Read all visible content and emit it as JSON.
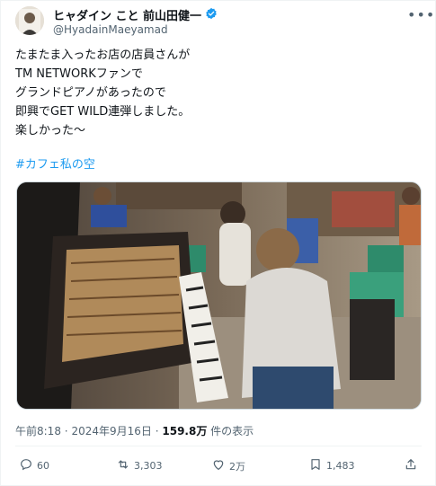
{
  "author": {
    "display_name": "ヒャダイン こと 前山田健一",
    "handle": "@HyadainMaeyamad"
  },
  "post": {
    "lines": [
      "たまたま入ったお店の店員さんが",
      "TM NETWORKファンで",
      "グランドピアノがあったので",
      "即興でGET WILD連弾しました。",
      "楽しかった〜"
    ],
    "hashtag": "#カフェ私の空"
  },
  "meta": {
    "time": "午前8:18",
    "date": "2024年9月16日",
    "views": "159.8万",
    "views_suffix": "件の表示",
    "separator": "·"
  },
  "actions": {
    "replies": "60",
    "reposts": "3,303",
    "likes": "2万",
    "bookmarks": "1,483"
  },
  "icons": {
    "more": "more-dots-icon",
    "verified": "verified-badge-icon",
    "reply": "reply-icon",
    "repost": "repost-icon",
    "like": "heart-icon",
    "bookmark": "bookmark-icon",
    "share": "share-icon"
  },
  "colors": {
    "accent": "#1d9bf0",
    "text": "#0f1419",
    "muted": "#536471"
  }
}
